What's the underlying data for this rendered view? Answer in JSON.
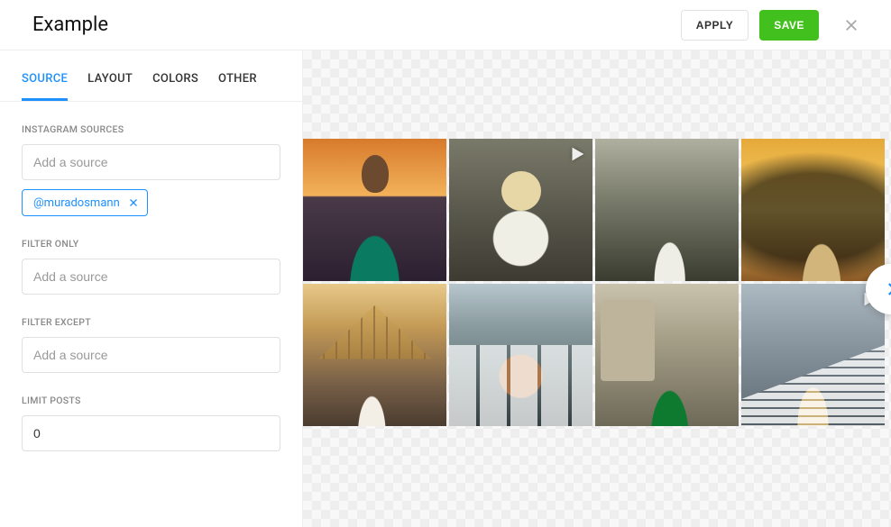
{
  "header": {
    "title": "Example",
    "apply": "APPLY",
    "save": "SAVE"
  },
  "tabs": {
    "source": "SOURCE",
    "layout": "LAYOUT",
    "colors": "COLORS",
    "other": "OTHER"
  },
  "sections": {
    "instagram_sources": {
      "label": "INSTAGRAM SOURCES",
      "placeholder": "Add a source",
      "chips": [
        "@muradosmann"
      ]
    },
    "filter_only": {
      "label": "FILTER ONLY",
      "placeholder": "Add a source"
    },
    "filter_except": {
      "label": "FILTER EXCEPT",
      "placeholder": "Add a source"
    },
    "limit_posts": {
      "label": "LIMIT POSTS",
      "value": "0"
    }
  },
  "gallery": {
    "items": [
      {
        "is_video": false
      },
      {
        "is_video": true
      },
      {
        "is_video": false
      },
      {
        "is_video": false
      },
      {
        "is_video": false
      },
      {
        "is_video": false
      },
      {
        "is_video": false
      },
      {
        "is_video": true
      }
    ]
  }
}
